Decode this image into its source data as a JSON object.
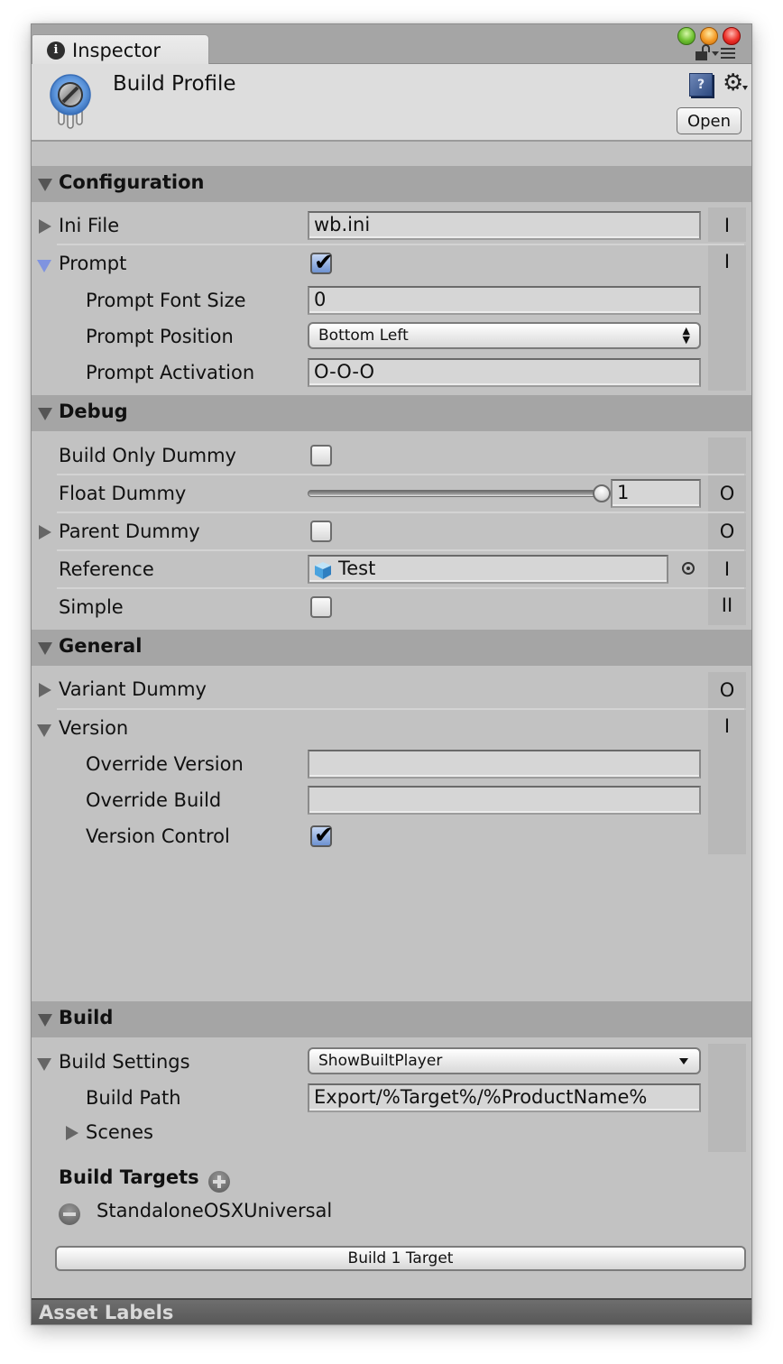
{
  "window": {
    "tab_label": "Inspector",
    "tab_icon": "info-icon"
  },
  "header": {
    "title": "Build Profile",
    "asset_icon": "potentiometer-icon",
    "help_icon": "help-book-icon",
    "gear_icon": "gear-icon",
    "open_button": "Open"
  },
  "sections": {
    "configuration": {
      "label": "Configuration",
      "ini_file": {
        "label": "Ini File",
        "value": "wb.ini",
        "side": "I"
      },
      "prompt": {
        "label": "Prompt",
        "checked": true,
        "side": "I",
        "font_size": {
          "label": "Prompt Font Size",
          "value": "0"
        },
        "position": {
          "label": "Prompt Position",
          "value": "Bottom Left"
        },
        "activation": {
          "label": "Prompt Activation",
          "value": "O-O-O"
        }
      }
    },
    "debug": {
      "label": "Debug",
      "build_only_dummy": {
        "label": "Build Only Dummy",
        "checked": false,
        "side": ""
      },
      "float_dummy": {
        "label": "Float Dummy",
        "value": "1",
        "slider_fraction": 1.0,
        "side": "O"
      },
      "parent_dummy": {
        "label": "Parent Dummy",
        "checked": false,
        "side": "O"
      },
      "reference": {
        "label": "Reference",
        "value": "Test",
        "side": "I"
      },
      "simple": {
        "label": "Simple",
        "checked": false,
        "side": "II"
      }
    },
    "general": {
      "label": "General",
      "variant_dummy": {
        "label": "Variant Dummy",
        "side": "O"
      },
      "version": {
        "label": "Version",
        "side": "I",
        "override_version": {
          "label": "Override Version",
          "value": ""
        },
        "override_build": {
          "label": "Override Build",
          "value": ""
        },
        "version_control": {
          "label": "Version Control",
          "checked": true
        }
      }
    },
    "build": {
      "label": "Build",
      "build_settings": {
        "label": "Build Settings",
        "value": "ShowBuiltPlayer"
      },
      "build_path": {
        "label": "Build Path",
        "value": "Export/%Target%/%ProductName%"
      },
      "scenes": {
        "label": "Scenes"
      },
      "build_targets": {
        "label": "Build Targets",
        "items": [
          "StandaloneOSXUniversal"
        ]
      },
      "build_button": "Build 1 Target"
    }
  },
  "footer": {
    "asset_labels": "Asset Labels"
  }
}
